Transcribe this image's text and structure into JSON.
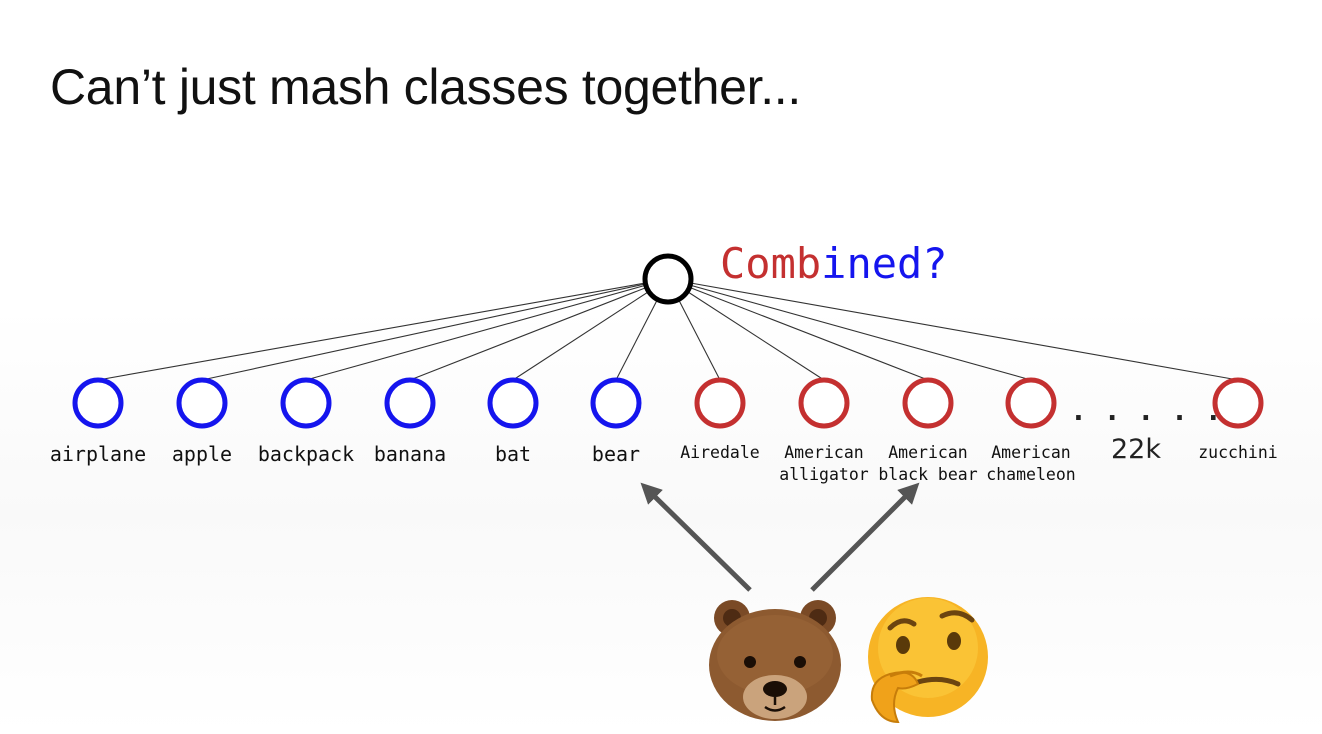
{
  "slide": {
    "title": "Can’t just mash classes together..."
  },
  "diagram": {
    "root_label": {
      "part1": "Comb",
      "part2": "ined?"
    },
    "ellipsis": ". . . . .",
    "count_label": "22k",
    "nodes": [
      {
        "id": "airplane",
        "lines": [
          "airplane"
        ],
        "group": "blue"
      },
      {
        "id": "apple",
        "lines": [
          "apple"
        ],
        "group": "blue"
      },
      {
        "id": "backpack",
        "lines": [
          "backpack"
        ],
        "group": "blue"
      },
      {
        "id": "banana",
        "lines": [
          "banana"
        ],
        "group": "blue"
      },
      {
        "id": "bat",
        "lines": [
          "bat"
        ],
        "group": "blue"
      },
      {
        "id": "bear",
        "lines": [
          "bear"
        ],
        "group": "blue"
      },
      {
        "id": "airedale",
        "lines": [
          "Airedale"
        ],
        "group": "red"
      },
      {
        "id": "american-alligator",
        "lines": [
          "American",
          "alligator"
        ],
        "group": "red"
      },
      {
        "id": "american-black-bear",
        "lines": [
          "American",
          "black bear"
        ],
        "group": "red"
      },
      {
        "id": "american-chameleon",
        "lines": [
          "American",
          "chameleon"
        ],
        "group": "red"
      },
      {
        "id": "zucchini",
        "lines": [
          "zucchini"
        ],
        "group": "red"
      }
    ],
    "emojis": {
      "bear": "bear-face",
      "thinking": "thinking-face"
    }
  },
  "colors": {
    "blue": "#1515ee",
    "red": "#c43030",
    "root": "#000000",
    "arrow": "#555555"
  }
}
